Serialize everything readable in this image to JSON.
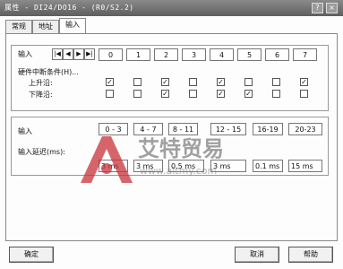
{
  "window": {
    "title": "属性 - DI24/DO16 - (R0/S2.2)",
    "help_glyph": "?",
    "close_glyph": "×"
  },
  "tabs": [
    "常规",
    "地址",
    "输入"
  ],
  "inputs_row": {
    "label": "输入",
    "nav_glyphs": [
      "|◀",
      "◀",
      "▶",
      "▶|"
    ],
    "channels": [
      "0",
      "1",
      "2",
      "3",
      "4",
      "5",
      "6",
      "7"
    ]
  },
  "interrupt": {
    "label": "硬件中断条件(H)...",
    "rising_label": "上升沿:",
    "falling_label": "下降沿:",
    "rising": [
      true,
      false,
      true,
      false,
      true,
      false,
      false,
      true
    ],
    "falling": [
      false,
      false,
      true,
      false,
      true,
      true,
      false,
      false
    ]
  },
  "delay_section": {
    "label": "输入",
    "groups": [
      "0 - 3",
      "4 - 7",
      "8 - 11",
      "12 - 15",
      "16-19",
      "20-23"
    ],
    "delay_label": "输入延迟(ms):",
    "values": [
      "3 ms",
      "3 ms",
      "0.5 ms",
      "3 ms",
      "0.1 ms",
      "15 ms"
    ]
  },
  "footer": {
    "ok": "确定",
    "cancel": "取消",
    "help": "帮助"
  },
  "watermark": {
    "text": "艾特贸易",
    "url": "www.aitmy.com"
  }
}
